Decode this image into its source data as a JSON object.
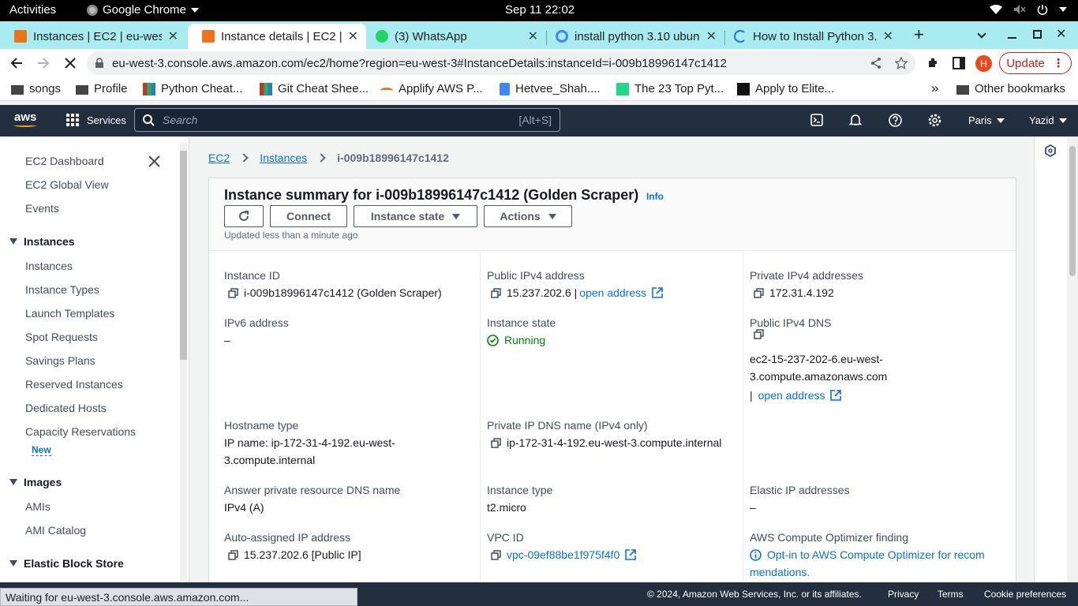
{
  "os": {
    "activities": "Activities",
    "app_name": "Google Chrome",
    "clock": "Sep 11  22:02"
  },
  "tabs": [
    {
      "title": "Instances | EC2 | eu-west",
      "icon": "aws-icon"
    },
    {
      "title": "Instance details | EC2 | eu",
      "icon": "aws-icon"
    },
    {
      "title": "(3) WhatsApp",
      "icon": "whatsapp-icon"
    },
    {
      "title": "install python 3.10 ubun",
      "icon": "google-icon"
    },
    {
      "title": "How to Install Python 3.",
      "icon": "loading-icon"
    }
  ],
  "browser": {
    "url": "eu-west-3.console.aws.amazon.com/ec2/home?region=eu-west-3#InstanceDetails:instanceId=i-009b18996147c1412",
    "profile_initial": "H",
    "update_label": "Update",
    "accent": "#c5221f"
  },
  "bookmarks": [
    {
      "label": "songs"
    },
    {
      "label": "Profile"
    },
    {
      "label": "Python Cheat..."
    },
    {
      "label": "Git Cheat Shee..."
    },
    {
      "label": "Applify AWS P..."
    },
    {
      "label": "Hetvee_Shah...."
    },
    {
      "label": "The 23 Top Pyt..."
    },
    {
      "label": "Apply to Elite..."
    }
  ],
  "bookmarks_other": "Other bookmarks",
  "aws_header": {
    "services": "Services",
    "search_placeholder": "Search",
    "search_shortcut": "[Alt+S]",
    "region": "Paris",
    "user": "Yazid",
    "bg_color": "#232f3e"
  },
  "sidebar": {
    "ec2_dashboard": "EC2 Dashboard",
    "ec2_global_view": "EC2 Global View",
    "events": "Events",
    "instances_section": "Instances",
    "instances_items": [
      "Instances",
      "Instance Types",
      "Launch Templates",
      "Spot Requests",
      "Savings Plans",
      "Reserved Instances",
      "Dedicated Hosts",
      "Capacity Reservations"
    ],
    "new_badge": "New",
    "images_section": "Images",
    "images_items": [
      "AMIs",
      "AMI Catalog"
    ],
    "ebs_section": "Elastic Block Store"
  },
  "breadcrumb": {
    "ec2": "EC2",
    "instances": "Instances",
    "current": "i-009b18996147c1412"
  },
  "summary": {
    "title": "Instance summary for i-009b18996147c1412 (Golden Scraper)",
    "info": "Info",
    "connect": "Connect",
    "instance_state_btn": "Instance state",
    "actions_btn": "Actions",
    "updated": "Updated less than a minute ago"
  },
  "details": {
    "instance_id_label": "Instance ID",
    "instance_id": "i-009b18996147c1412 (Golden Scraper)",
    "public_ipv4_label": "Public IPv4 address",
    "public_ipv4": "15.237.202.6 |",
    "open_address": "open address",
    "private_ipv4_label": "Private IPv4 addresses",
    "private_ipv4": "172.31.4.192",
    "ipv6_label": "IPv6 address",
    "ipv6": "–",
    "state_label": "Instance state",
    "state": "Running",
    "state_color": "#037f0c",
    "public_dns_label": "Public IPv4 DNS",
    "public_dns_line1": "ec2-15-237-202-6.eu-west-",
    "public_dns_line2": "3.compute.amazonaws.com",
    "public_dns_sep": "|",
    "hostname_type_label": "Hostname type",
    "hostname_line1": "IP name: ip-172-31-4-192.eu-west-",
    "hostname_line2": "3.compute.internal",
    "private_dns_label": "Private IP DNS name (IPv4 only)",
    "private_dns": "ip-172-31-4-192.eu-west-3.compute.internal",
    "answer_dns_label": "Answer private resource DNS name",
    "answer_dns": "IPv4 (A)",
    "instance_type_label": "Instance type",
    "instance_type": "t2.micro",
    "elastic_ip_label": "Elastic IP addresses",
    "elastic_ip": "–",
    "auto_ip_label": "Auto-assigned IP address",
    "auto_ip": "15.237.202.6 [Public IP]",
    "vpc_label": "VPC ID",
    "vpc": "vpc-09ef88be1f975f4f0",
    "optimizer_label": "AWS Compute Optimizer finding",
    "optimizer_line1": "Opt-in to AWS Compute Optimizer for recom",
    "optimizer_line2": "mendations."
  },
  "footer": {
    "copyright": "© 2024, Amazon Web Services, Inc. or its affiliates.",
    "privacy": "Privacy",
    "terms": "Terms",
    "cookies": "Cookie preferences"
  },
  "status_bar": "Waiting for eu-west-3.console.aws.amazon.com..."
}
